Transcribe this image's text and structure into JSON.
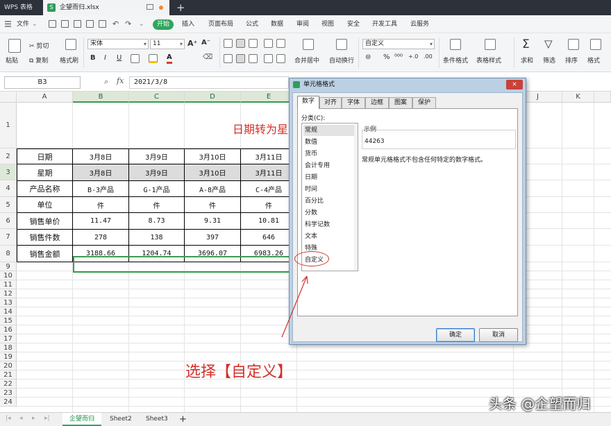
{
  "titlebar": {
    "app_tab": "WPS 表格",
    "file_tab": "企望而归.xlsx",
    "file_icon": "S",
    "new_tab": "+"
  },
  "menubar": {
    "file_menu": "文件",
    "items": [
      "开始",
      "插入",
      "页面布局",
      "公式",
      "数据",
      "审阅",
      "视图",
      "安全",
      "开发工具",
      "云服务"
    ],
    "active": "开始"
  },
  "ribbon": {
    "paste": "粘贴",
    "cut": "剪切",
    "copy": "复制",
    "format_painter": "格式刷",
    "font_name": "宋体",
    "font_size": "11",
    "bold": "B",
    "italic": "I",
    "underline": "U",
    "merge_center": "合并居中",
    "wrap_text": "自动换行",
    "number_format": "自定义",
    "conditional_format": "条件格式",
    "table_style": "表格样式",
    "sum": "求和",
    "filter": "筛选",
    "sort": "排序",
    "format": "格式"
  },
  "formulabar": {
    "name_box": "B3",
    "fx": "fx",
    "formula": "2021/3/8"
  },
  "sheet": {
    "columns": [
      "A",
      "B",
      "C",
      "D",
      "E",
      "J",
      "K"
    ],
    "rows": [
      "1",
      "2",
      "3",
      "4",
      "5",
      "6",
      "7",
      "8",
      "9",
      "10",
      "11",
      "12",
      "13",
      "14",
      "15",
      "16",
      "17",
      "18",
      "19",
      "20",
      "21",
      "22",
      "23",
      "24"
    ],
    "title": "日期转为星",
    "table": {
      "labels": [
        "日期",
        "星期",
        "产品名称",
        "单位",
        "销售单价",
        "销售件数",
        "销售金额"
      ],
      "B": [
        "3月8日",
        "3月8日",
        "B-3产品",
        "件",
        "11.47",
        "278",
        "3188.66"
      ],
      "C": [
        "3月9日",
        "3月9日",
        "G-1产品",
        "件",
        "8.73",
        "138",
        "1204.74"
      ],
      "D": [
        "3月10日",
        "3月10日",
        "A-8产品",
        "件",
        "9.31",
        "397",
        "3696.07"
      ],
      "E": [
        "3月11日",
        "3月11日",
        "C-4产品",
        "件",
        "10.81",
        "646",
        "6983.26"
      ]
    },
    "annotation": "选择【自定义】"
  },
  "sheet_tabs": [
    "企望而归",
    "Sheet2",
    "Sheet3"
  ],
  "add_sheet": "+",
  "watermark": "头条 @企望而归",
  "dialog": {
    "title": "单元格格式",
    "close": "×",
    "tabs": [
      "数字",
      "对齐",
      "字体",
      "边框",
      "图案",
      "保护"
    ],
    "category_label": "分类(C):",
    "categories": [
      "常规",
      "数值",
      "货币",
      "会计专用",
      "日期",
      "时间",
      "百分比",
      "分数",
      "科学记数",
      "文本",
      "特殊",
      "自定义"
    ],
    "sample_label": "示例",
    "sample_value": "44263",
    "description": "常规单元格格式不包含任何特定的数字格式。",
    "ok": "确定",
    "cancel": "取消"
  },
  "colors": {
    "accent_green": "#2fa65d",
    "annotation_red": "#d4302b"
  }
}
